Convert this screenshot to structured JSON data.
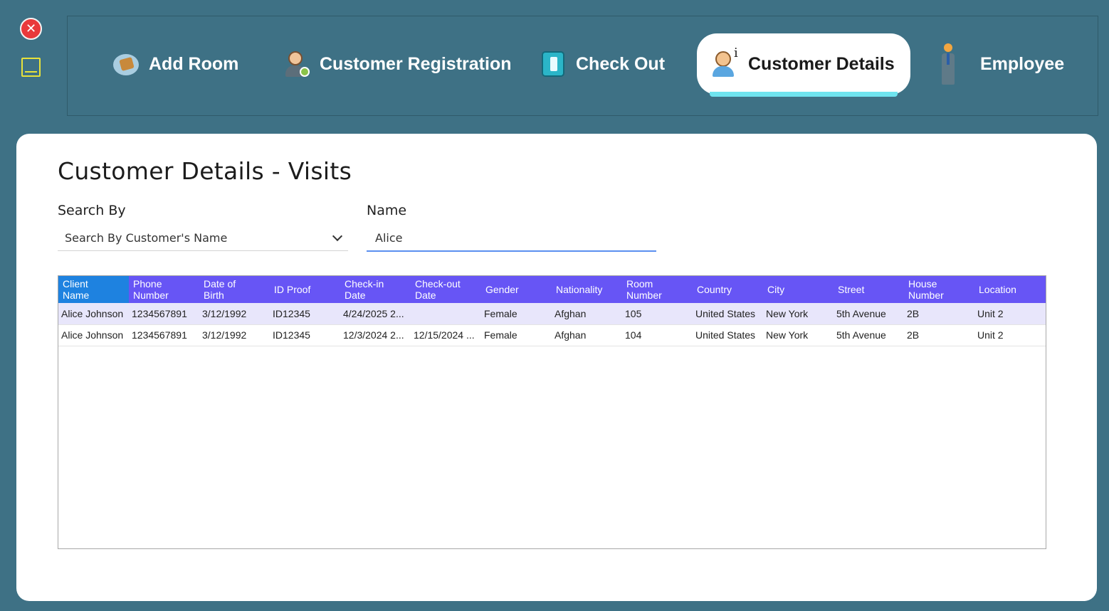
{
  "window": {
    "close_icon": "close-icon",
    "minimize_icon": "minimize-icon"
  },
  "nav": {
    "items": [
      {
        "label": "Add Room",
        "icon": "add-room-icon"
      },
      {
        "label": "Customer Registration",
        "icon": "customer-registration-icon"
      },
      {
        "label": "Check Out",
        "icon": "check-out-icon"
      },
      {
        "label": "Customer Details",
        "icon": "customer-details-icon",
        "active": true
      },
      {
        "label": "Employee",
        "icon": "employee-icon"
      }
    ]
  },
  "page": {
    "title": "Customer Details  - Visits",
    "search_by_label": "Search By",
    "search_by_value": "Search By Customer's Name",
    "name_label": "Name",
    "name_value": "Alice"
  },
  "table": {
    "columns": [
      [
        "Client",
        "Name"
      ],
      [
        "Phone",
        "Number"
      ],
      [
        "Date of",
        "Birth"
      ],
      [
        "ID Proof",
        ""
      ],
      [
        "Check-in",
        "Date"
      ],
      [
        "Check-out",
        "Date"
      ],
      [
        "Gender",
        ""
      ],
      [
        "Nationality",
        ""
      ],
      [
        "Room",
        "Number"
      ],
      [
        "Country",
        ""
      ],
      [
        "City",
        ""
      ],
      [
        "Street",
        ""
      ],
      [
        "House",
        "Number"
      ],
      [
        "Location",
        ""
      ]
    ],
    "rows": [
      [
        "Alice Johnson",
        "1234567891",
        "3/12/1992",
        "ID12345",
        "4/24/2025 2...",
        "",
        "Female",
        "Afghan",
        "105",
        "United States",
        "New York",
        "5th Avenue",
        "2B",
        "Unit 2"
      ],
      [
        "Alice Johnson",
        "1234567891",
        "3/12/1992",
        "ID12345",
        "12/3/2024 2...",
        "12/15/2024 ...",
        "Female",
        "Afghan",
        "104",
        "United States",
        "New York",
        "5th Avenue",
        "2B",
        "Unit 2"
      ]
    ]
  },
  "colors": {
    "background": "#3e7185",
    "header": "#6755f5",
    "selected_header": "#1e82e0",
    "active_tab_underline": "#6fe4ef"
  }
}
